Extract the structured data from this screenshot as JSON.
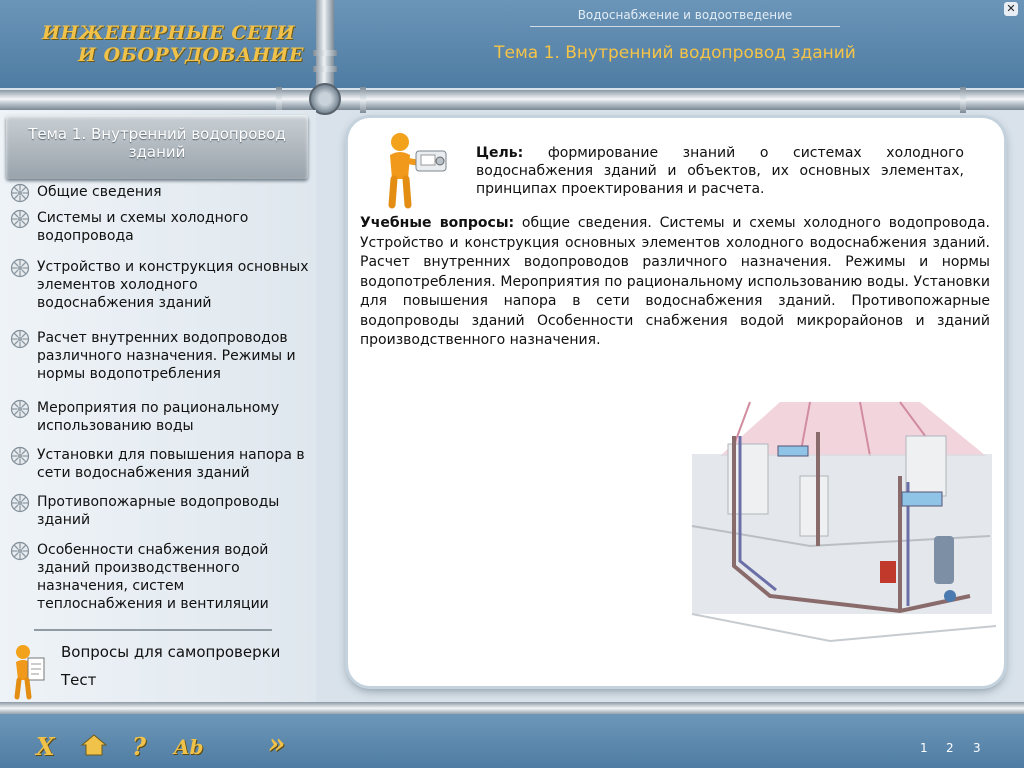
{
  "header": {
    "logo_line1": "ИНЖЕНЕРНЫЕ СЕТИ",
    "logo_line2": "И ОБОРУДОВАНИЕ",
    "subject": "Водоснабжение и водоотведение",
    "topic": "Тема 1. Внутренний водопровод зданий",
    "close_icon": "close-icon"
  },
  "sidebar": {
    "title": "Тема 1. Внутренний водопровод зданий",
    "items": [
      {
        "label": "Общие сведения"
      },
      {
        "label": "Системы и схемы холодного водопровода"
      },
      {
        "label": "Устройство и конструкция основных элементов холодного водоснабжения зданий"
      },
      {
        "label": "Расчет внутренних водопроводов различного назначения. Режимы и нормы водопотребления"
      },
      {
        "label": "Мероприятия по рациональному использованию воды"
      },
      {
        "label": "Установки для повышения напора в сети водоснабжения зданий"
      },
      {
        "label": "Противопожарные водопроводы зданий"
      },
      {
        "label": "Особенности снабжения водой зданий производственного назначения, систем теплоснабжения и вентиляции"
      }
    ],
    "self_check": "Вопросы для самопроверки",
    "test": "Тест"
  },
  "main": {
    "goal_label": "Цель:",
    "goal_text": " формирование знаний о системах холодного водоснабжения зданий и объектов, их основных элементах, принципах проектирования и расчета.",
    "questions_label": "Учебные вопросы:",
    "questions_text": " общие сведения. Системы и схемы холодного водопровода. Устройство и конструкция основных элементов холодного водоснабжения зданий. Расчет внутренних водопроводов различного назначения. Режимы и нормы водопотребления. Мероприятия по рациональному использованию воды. Установки для повышения напора в сети водоснабжения зданий. Противопожарные водопроводы зданий Особенности снабжения водой микрорайонов и зданий производственного назначения."
  },
  "footer": {
    "exit": "X",
    "help": "?",
    "font": "Ab",
    "next": "»",
    "pages": [
      "1",
      "2",
      "3"
    ]
  },
  "colors": {
    "accent": "#f0c24a",
    "header_bg": "#5a87ad"
  }
}
